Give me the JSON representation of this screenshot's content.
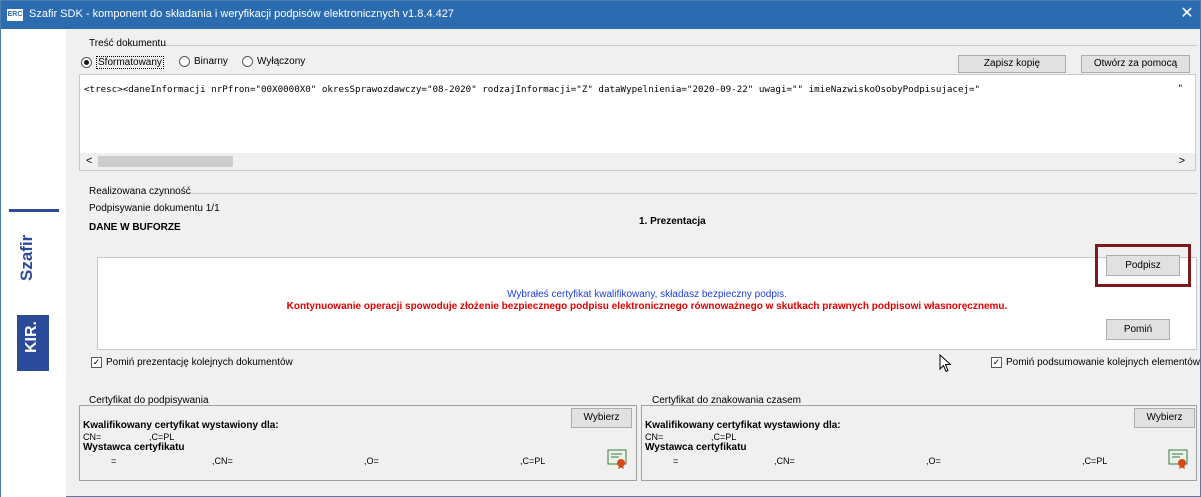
{
  "window": {
    "app_icon_text": "ERC",
    "title": "Szafir SDK - komponent do składania i weryfikacji podpisów elektronicznych v1.8.4.427",
    "close_glyph": "✕"
  },
  "sidebar": {
    "brand_top": "Szafir",
    "brand_bottom": "KIR."
  },
  "content_group": {
    "label": "Treść dokumentu",
    "radios": [
      {
        "label": "Sformatowany",
        "selected": true
      },
      {
        "label": "Binarny",
        "selected": false
      },
      {
        "label": "Wyłączony",
        "selected": false
      }
    ],
    "save_copy_label": "Zapisz kopię",
    "open_with_label": "Otwórz za pomocą",
    "code_text": "<tresc><daneInformacji nrPfron=\"00X0000X0\" okresSprawozdawczy=\"08-2020\" rodzajInformacji=\"Z\" dataWypelnienia=\"2020-09-22\" uwagi=\"\" imieNazwiskoOsobyPodpisujacej=\"",
    "code_trailing": "\"",
    "scroll_left": "<",
    "scroll_right": ">"
  },
  "activity_group": {
    "label": "Realizowana czynność",
    "progress_text": "Podpisywanie dokumentu 1/1",
    "buffer_text": "DANE W BUFORZE",
    "stage_title": "1. Prezentacja",
    "message_info": "Wybrałeś certyfikat kwalifikowany, składasz bezpieczny podpis.",
    "message_warning": "Kontynuowanie operacji spowoduje złożenie bezpiecznego podpisu elektronicznego równoważnego w skutkach prawnych podpisowi własnoręcznemu.",
    "sign_label": "Podpisz",
    "skip_label": "Pomiń"
  },
  "options": {
    "skip_presentation_label": "Pomiń prezentację kolejnych dokumentów",
    "skip_summary_label": "Pomiń podsumowanie kolejnych elementów",
    "check_glyph": "✓"
  },
  "signing_cert": {
    "label": "Certyfikat do podpisywania",
    "choose_label": "Wybierz",
    "heading": "Kwalifikowany certyfikat wystawiony dla:",
    "subject_cn": "CN=",
    "subject_c": ",C=PL",
    "issuer_heading": "Wystawca certyfikatu",
    "issuer_eq": "=",
    "issuer_cn": ",CN=",
    "issuer_o": ",O=",
    "issuer_c": ",C=PL"
  },
  "timestamp_cert": {
    "label": "Certyfikat do znakowania czasem",
    "choose_label": "Wybierz",
    "heading": "Kwalifikowany certyfikat wystawiony dla:",
    "subject_cn": "CN=",
    "subject_c": ",C=PL",
    "issuer_heading": "Wystawca certyfikatu",
    "issuer_eq": "=",
    "issuer_cn": ",CN=",
    "issuer_o": ",O=",
    "issuer_c": ",C=PL"
  },
  "colors": {
    "accent": "#2b6cb0",
    "brand": "#2b4a9a",
    "warning": "#e00000",
    "info": "#1f3fe0",
    "highlight": "#7a1a1a"
  }
}
